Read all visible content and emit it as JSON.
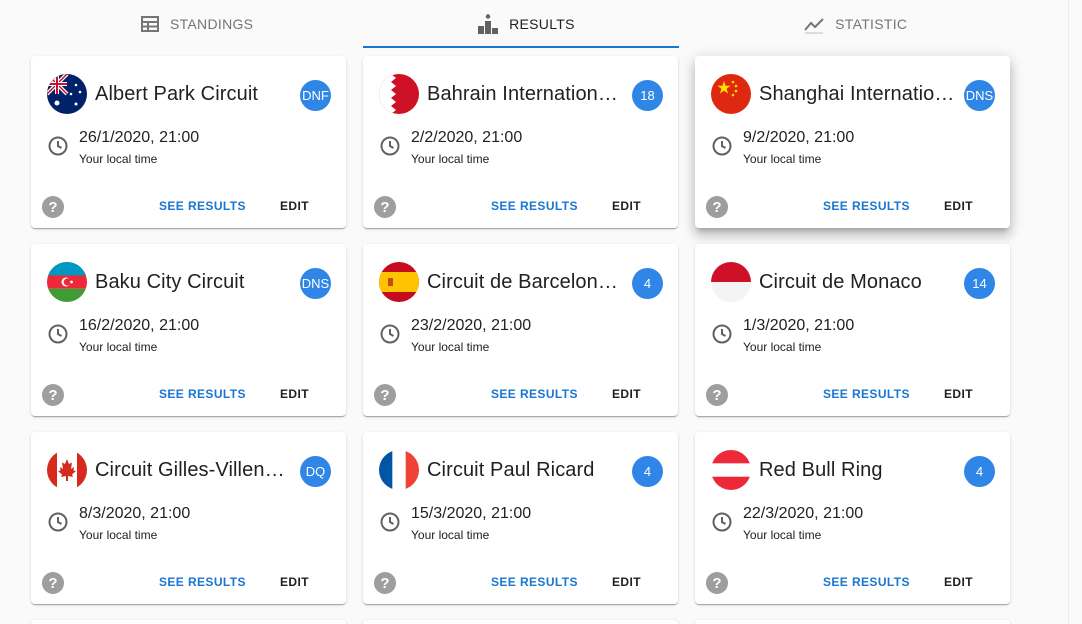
{
  "tabs": [
    {
      "label": "STANDINGS",
      "icon": "table-icon"
    },
    {
      "label": "RESULTS",
      "icon": "podium-icon",
      "active": true
    },
    {
      "label": "STATISTIC",
      "icon": "trending-icon"
    }
  ],
  "colors": {
    "accent": "#1976d2",
    "badge": "#2f86e6"
  },
  "races": [
    {
      "title": "Albert Park Circuit",
      "flag": "australia-flag-icon",
      "badge": "DNF",
      "date": "26/1/2020, 21:00",
      "local": "Your local time",
      "see_results": "SEE RESULTS",
      "edit": "EDIT"
    },
    {
      "title": "Bahrain International Circuit",
      "flag": "bahrain-flag-icon",
      "badge": "18",
      "date": "2/2/2020, 21:00",
      "local": "Your local time",
      "see_results": "SEE RESULTS",
      "edit": "EDIT"
    },
    {
      "title": "Shanghai International Circuit",
      "flag": "china-flag-icon",
      "badge": "DNS",
      "date": "9/2/2020, 21:00",
      "local": "Your local time",
      "see_results": "SEE RESULTS",
      "edit": "EDIT"
    },
    {
      "title": "Baku City Circuit",
      "flag": "azerbaijan-flag-icon",
      "badge": "DNS",
      "date": "16/2/2020, 21:00",
      "local": "Your local time",
      "see_results": "SEE RESULTS",
      "edit": "EDIT"
    },
    {
      "title": "Circuit de Barcelona-Catalunya",
      "flag": "spain-flag-icon",
      "badge": "4",
      "date": "23/2/2020, 21:00",
      "local": "Your local time",
      "see_results": "SEE RESULTS",
      "edit": "EDIT"
    },
    {
      "title": "Circuit de Monaco",
      "flag": "monaco-flag-icon",
      "badge": "14",
      "date": "1/3/2020, 21:00",
      "local": "Your local time",
      "see_results": "SEE RESULTS",
      "edit": "EDIT"
    },
    {
      "title": "Circuit Gilles-Villeneuve",
      "flag": "canada-flag-icon",
      "badge": "DQ",
      "date": "8/3/2020, 21:00",
      "local": "Your local time",
      "see_results": "SEE RESULTS",
      "edit": "EDIT"
    },
    {
      "title": "Circuit Paul Ricard",
      "flag": "france-flag-icon",
      "badge": "4",
      "date": "15/3/2020, 21:00",
      "local": "Your local time",
      "see_results": "SEE RESULTS",
      "edit": "EDIT"
    },
    {
      "title": "Red Bull Ring",
      "flag": "austria-flag-icon",
      "badge": "4",
      "date": "22/3/2020, 21:00",
      "local": "Your local time",
      "see_results": "SEE RESULTS",
      "edit": "EDIT"
    }
  ],
  "help_glyph": "?"
}
